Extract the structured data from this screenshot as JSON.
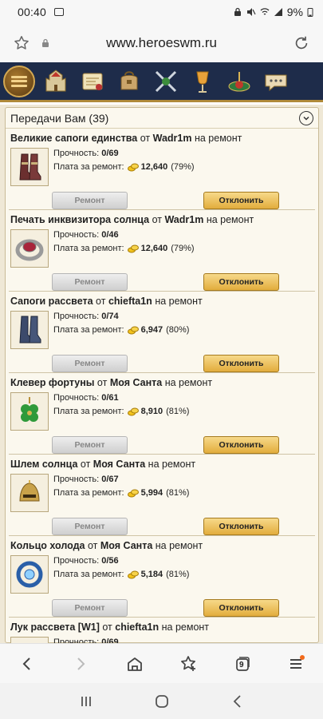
{
  "status_bar": {
    "time": "00:40",
    "battery": "9%"
  },
  "browser": {
    "url": "www.heroeswm.ru",
    "tab_count": "9"
  },
  "game_nav": {
    "icons": [
      "menu-icon",
      "castle-icon",
      "map-scroll-icon",
      "bag-icon",
      "crossed-swords-icon",
      "goblet-icon",
      "roulette-icon",
      "chat-icon"
    ]
  },
  "panel": {
    "title": "Передачи Вам (39)"
  },
  "labels": {
    "from": "от",
    "for_repair": "на ремонт",
    "durability": "Прочность:",
    "repair_fee": "Плата за ремонт:",
    "repair_button": "Ремонт",
    "decline_button": "Отклонить"
  },
  "transfers": [
    {
      "item": "Великие сапоги единства",
      "sender": "Wadr1m",
      "durability": "0/69",
      "fee": "12,640",
      "percent": "(79%)"
    },
    {
      "item": "Печать инквизитора солнца",
      "sender": "Wadr1m",
      "durability": "0/46",
      "fee": "12,640",
      "percent": "(79%)"
    },
    {
      "item": "Сапоги рассвета",
      "sender": "chiefta1n",
      "durability": "0/74",
      "fee": "6,947",
      "percent": "(80%)"
    },
    {
      "item": "Клевер фортуны",
      "sender": "Моя Санта",
      "durability": "0/61",
      "fee": "8,910",
      "percent": "(81%)"
    },
    {
      "item": "Шлем солнца",
      "sender": "Моя Санта",
      "durability": "0/67",
      "fee": "5,994",
      "percent": "(81%)"
    },
    {
      "item": "Кольцо холода",
      "sender": "Моя Санта",
      "durability": "0/56",
      "fee": "5,184",
      "percent": "(81%)"
    },
    {
      "item": "Лук рассвета [W1]",
      "sender": "chiefta1n",
      "durability": "0/69",
      "fee": "",
      "percent": ""
    }
  ]
}
